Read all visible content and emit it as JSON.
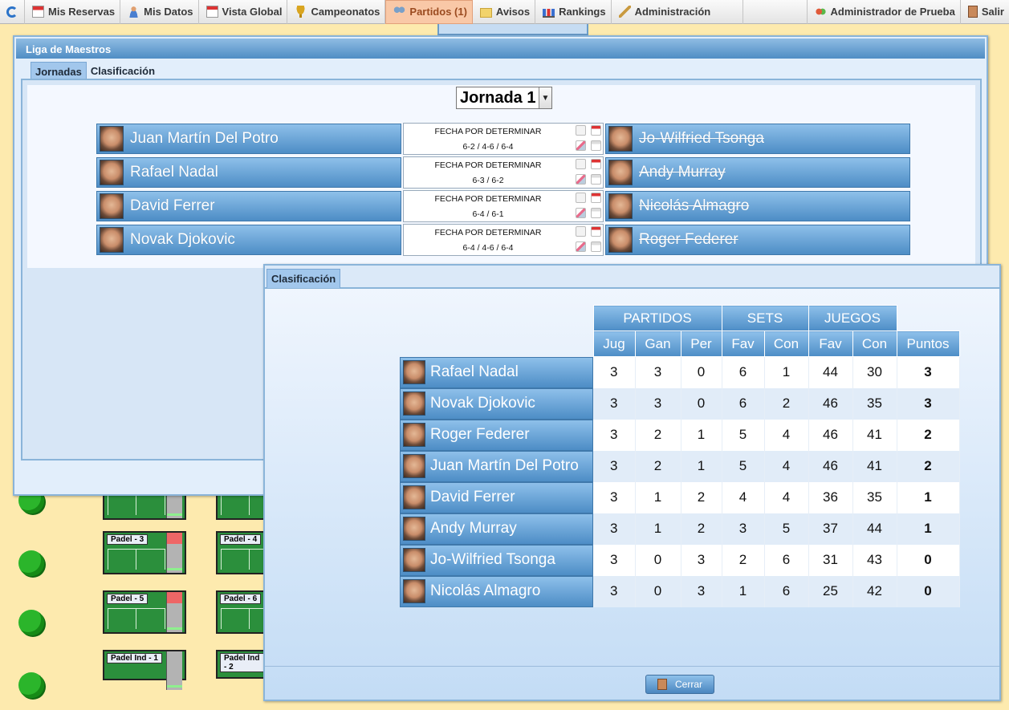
{
  "nav": {
    "items": [
      {
        "label": "Mis Reservas",
        "icon": "calendar-icon"
      },
      {
        "label": "Mis Datos",
        "icon": "user-icon"
      },
      {
        "label": "Vista Global",
        "icon": "calendar-grid-icon"
      },
      {
        "label": "Campeonatos",
        "icon": "trophy-icon"
      },
      {
        "label": "Partidos (1)",
        "icon": "players-icon",
        "active": true
      },
      {
        "label": "Avisos",
        "icon": "folder-icon"
      },
      {
        "label": "Rankings",
        "icon": "bar-chart-icon"
      },
      {
        "label": "Administración",
        "icon": "wrench-icon"
      }
    ],
    "user": "Administrador de Prueba",
    "logout": "Salir"
  },
  "courts": [
    "Padel - 3",
    "Padel - 4",
    "Padel - 5",
    "Padel - 6",
    "Padel Ind - 1",
    "Padel Ind - 2"
  ],
  "liga": {
    "title": "Liga de Maestros",
    "tabs": [
      "Jornadas",
      "Clasificación"
    ],
    "jornada": "Jornada 1",
    "matches": [
      {
        "home": "Juan Martín Del Potro",
        "away": "Jo-Wilfried Tsonga",
        "date": "FECHA POR DETERMINAR",
        "score": "6-2 / 4-6 / 6-4"
      },
      {
        "home": "Rafael Nadal",
        "away": "Andy Murray",
        "date": "FECHA POR DETERMINAR",
        "score": "6-3 / 6-2"
      },
      {
        "home": "David Ferrer",
        "away": "Nicolás Almagro",
        "date": "FECHA POR DETERMINAR",
        "score": "6-4 / 6-1"
      },
      {
        "home": "Novak Djokovic",
        "away": "Roger Federer",
        "date": "FECHA POR DETERMINAR",
        "score": "6-4 / 4-6 / 6-4"
      }
    ]
  },
  "clasificacion": {
    "tab": "Clasificación",
    "groups": [
      "PARTIDOS",
      "SETS",
      "JUEGOS"
    ],
    "columns": [
      "Jug",
      "Gan",
      "Per",
      "Fav",
      "Con",
      "Fav",
      "Con",
      "Puntos"
    ],
    "rows": [
      {
        "name": "Rafael Nadal",
        "vals": [
          "3",
          "3",
          "0",
          "6",
          "1",
          "44",
          "30",
          "3"
        ]
      },
      {
        "name": "Novak Djokovic",
        "vals": [
          "3",
          "3",
          "0",
          "6",
          "2",
          "46",
          "35",
          "3"
        ]
      },
      {
        "name": "Roger Federer",
        "vals": [
          "3",
          "2",
          "1",
          "5",
          "4",
          "46",
          "41",
          "2"
        ]
      },
      {
        "name": "Juan Martín Del Potro",
        "vals": [
          "3",
          "2",
          "1",
          "5",
          "4",
          "46",
          "41",
          "2"
        ]
      },
      {
        "name": "David Ferrer",
        "vals": [
          "3",
          "1",
          "2",
          "4",
          "4",
          "36",
          "35",
          "1"
        ]
      },
      {
        "name": "Andy Murray",
        "vals": [
          "3",
          "1",
          "2",
          "3",
          "5",
          "37",
          "44",
          "1"
        ]
      },
      {
        "name": "Jo-Wilfried Tsonga",
        "vals": [
          "3",
          "0",
          "3",
          "2",
          "6",
          "31",
          "43",
          "0"
        ]
      },
      {
        "name": "Nicolás Almagro",
        "vals": [
          "3",
          "0",
          "3",
          "1",
          "6",
          "25",
          "42",
          "0"
        ]
      }
    ],
    "close": "Cerrar"
  }
}
